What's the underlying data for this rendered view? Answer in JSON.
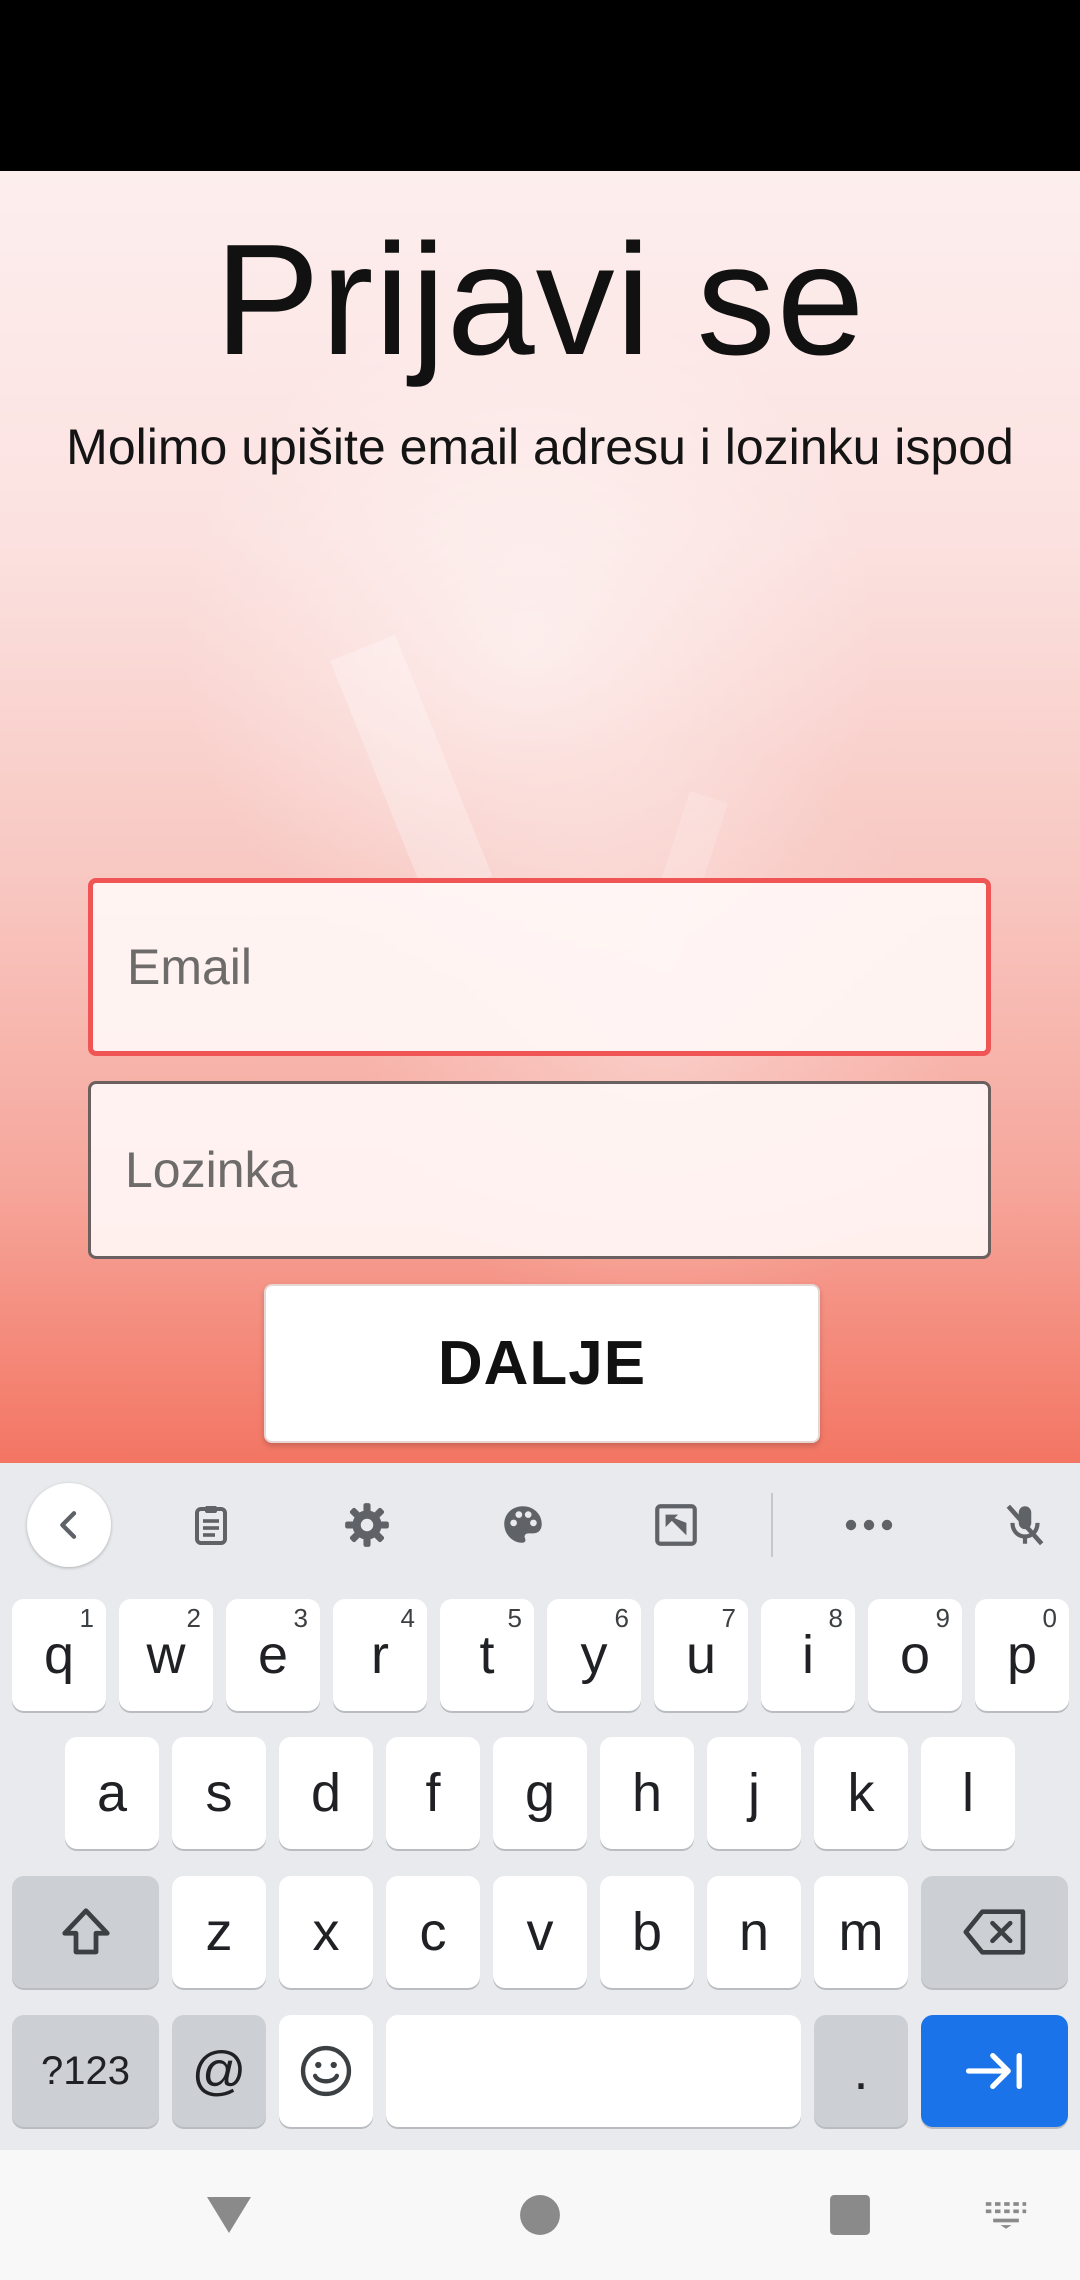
{
  "login": {
    "title": "Prijavi se",
    "subtitle": "Molimo upišite email adresu i lozinku ispod",
    "email_placeholder": "Email",
    "password_placeholder": "Lozinka",
    "next_label": "DALJE"
  },
  "colors": {
    "email_border": "#ef5555",
    "enter_key": "#1a73e8",
    "background_top": "#fdeeee",
    "background_bottom": "#f37563"
  },
  "keyboard": {
    "toolbar_icons": [
      "chevron-left-icon",
      "clipboard-icon",
      "gear-icon",
      "palette-icon",
      "resize-icon",
      "more-icon",
      "mic-off-icon"
    ],
    "row1": [
      {
        "key": "q",
        "hint": "1"
      },
      {
        "key": "w",
        "hint": "2"
      },
      {
        "key": "e",
        "hint": "3"
      },
      {
        "key": "r",
        "hint": "4"
      },
      {
        "key": "t",
        "hint": "5"
      },
      {
        "key": "y",
        "hint": "6"
      },
      {
        "key": "u",
        "hint": "7"
      },
      {
        "key": "i",
        "hint": "8"
      },
      {
        "key": "o",
        "hint": "9"
      },
      {
        "key": "p",
        "hint": "0"
      }
    ],
    "row2": [
      "a",
      "s",
      "d",
      "f",
      "g",
      "h",
      "j",
      "k",
      "l"
    ],
    "row3": [
      "z",
      "x",
      "c",
      "v",
      "b",
      "n",
      "m"
    ],
    "symbols_label": "?123",
    "at_label": "@",
    "period_label": "."
  },
  "navigation": {
    "icons": [
      "back-triangle-icon",
      "home-circle-icon",
      "recents-square-icon",
      "keyboard-switch-icon"
    ]
  }
}
